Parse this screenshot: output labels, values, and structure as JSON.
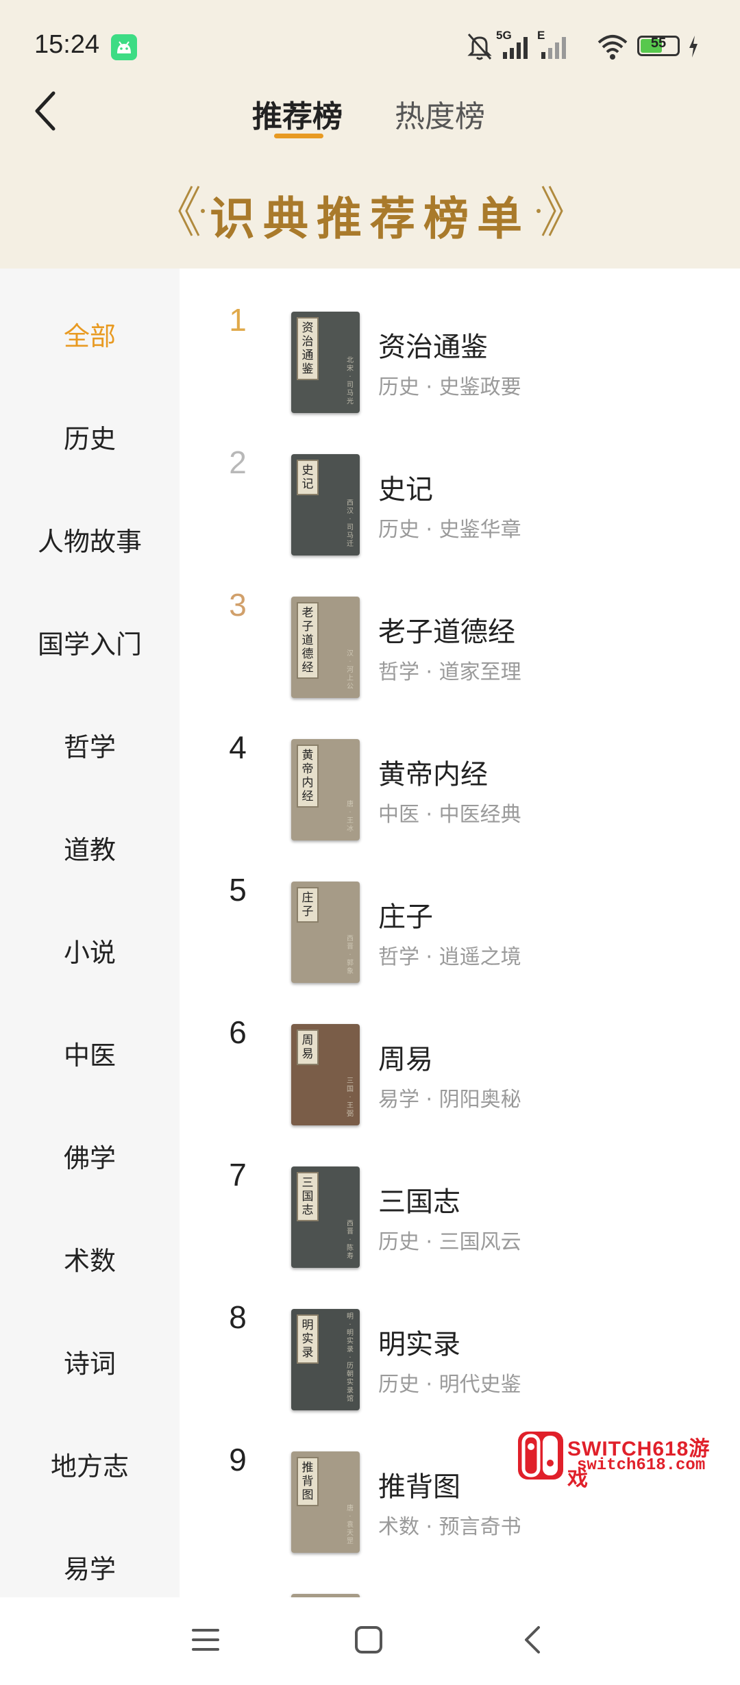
{
  "status_bar": {
    "time": "15:24",
    "network_5g": "5G",
    "network_e": "E",
    "battery": "55"
  },
  "tabs": [
    {
      "label": "推荐榜",
      "selected": true
    },
    {
      "label": "热度榜",
      "selected": false
    }
  ],
  "banner": {
    "title": "识典推荐榜单"
  },
  "sidebar": {
    "items": [
      {
        "label": "全部",
        "active": true
      },
      {
        "label": "历史"
      },
      {
        "label": "人物故事"
      },
      {
        "label": "国学入门"
      },
      {
        "label": "哲学"
      },
      {
        "label": "道教"
      },
      {
        "label": "小说"
      },
      {
        "label": "中医"
      },
      {
        "label": "佛学"
      },
      {
        "label": "术数"
      },
      {
        "label": "诗词"
      },
      {
        "label": "地方志"
      },
      {
        "label": "易学"
      }
    ]
  },
  "books": [
    {
      "rank": "1",
      "title": "资治通鉴",
      "meta": "历史 · 史鉴政要",
      "cover_text": "资治通鉴",
      "cover_author": "北宋·司马光",
      "cover_color": "#505552"
    },
    {
      "rank": "2",
      "title": "史记",
      "meta": "历史 · 史鉴华章",
      "cover_text": "史记",
      "cover_author": "西汉·司马迁",
      "cover_color": "#4d5250"
    },
    {
      "rank": "3",
      "title": "老子道德经",
      "meta": "哲学 · 道家至理",
      "cover_text": "老子道德经",
      "cover_author": "汉·河上公",
      "cover_color": "#a59a86"
    },
    {
      "rank": "4",
      "title": "黄帝内经",
      "meta": "中医 · 中医经典",
      "cover_text": "黄帝内经",
      "cover_author": "唐·王冰",
      "cover_color": "#a79c88"
    },
    {
      "rank": "5",
      "title": "庄子",
      "meta": "哲学 · 逍遥之境",
      "cover_text": "庄子",
      "cover_author": "西晋·郭象",
      "cover_color": "#a69b87"
    },
    {
      "rank": "6",
      "title": "周易",
      "meta": "易学 · 阴阳奥秘",
      "cover_text": "周易",
      "cover_author": "三国·王弼",
      "cover_color": "#7a5d48"
    },
    {
      "rank": "7",
      "title": "三国志",
      "meta": "历史 · 三国风云",
      "cover_text": "三国志",
      "cover_author": "西晋·陈寿",
      "cover_color": "#4d5250"
    },
    {
      "rank": "8",
      "title": "明实录",
      "meta": "历史 · 明代史鉴",
      "cover_text": "明实录",
      "cover_author": "明·明实录·历朝实录馆",
      "cover_color": "#4a4f4d"
    },
    {
      "rank": "9",
      "title": "推背图",
      "meta": "术数 · 预言奇书",
      "cover_text": "推背图",
      "cover_author": "唐·袁天罡",
      "cover_color": "#a69b87"
    }
  ],
  "watermark": {
    "line1": "SWITCH618游戏",
    "line2": "switch618.com"
  },
  "icons": {
    "back": "chevron-left-icon",
    "nav_menu": "menu-icon",
    "nav_home": "home-square-icon",
    "nav_back": "back-arrow-icon"
  },
  "colors": {
    "accent": "#e89a22",
    "header_bg": "#f4efe3",
    "banner_title": "#a97a2b"
  }
}
